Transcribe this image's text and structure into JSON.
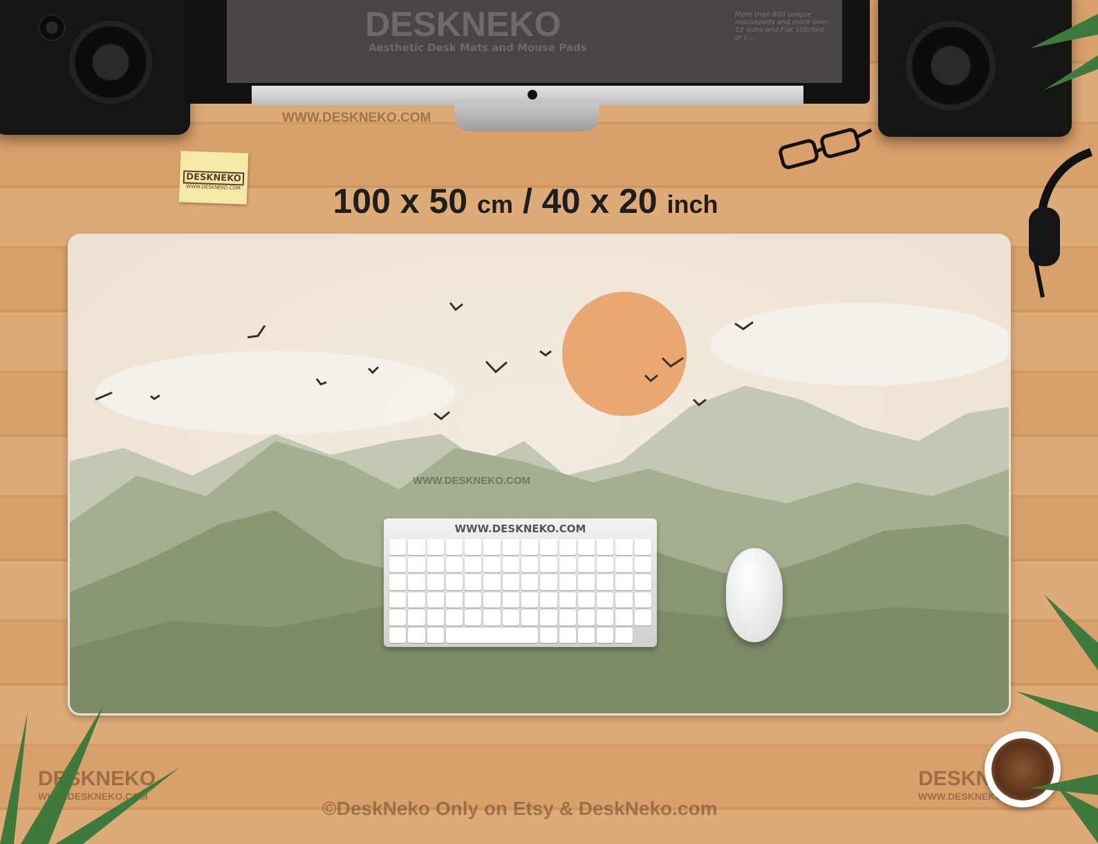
{
  "monitor": {
    "screen_brand": "DESKNEKO",
    "screen_tagline": "Aesthetic Desk Mats and Mouse Pads",
    "screen_side_text": "More than 800 unique mousepads and more over 12 sizes and Flat Stitched or L..."
  },
  "watermarks": {
    "url_top": "WWW.DESKNEKO.COM",
    "url_mat": "WWW.DESKNEKO.COM",
    "url_keyboard": "WWW.DESKNEKO.COM",
    "copyright": "©DeskNeko Only on Etsy & DeskNeko.com",
    "logo_left": "DESKNEKO",
    "logo_left_url": "WWW.DESKNEKO.COM",
    "logo_right": "DESKNEKO",
    "logo_right_url": "WWW.DESKNEKO.COM"
  },
  "sticky_note": {
    "brand": "DESKNEKO",
    "url": "WWW.DESKNEKO.COM"
  },
  "dimensions": {
    "cm_value": "100 x 50",
    "cm_unit": "cm",
    "sep": "/",
    "inch_value": "40 x 20",
    "inch_unit": "inch"
  },
  "colors": {
    "wood": "#d8a06b",
    "sky": "#efe5d8",
    "sun": "#eba771",
    "mountain_light": "#b5bea4",
    "mountain_mid": "#98a584",
    "mountain_dark": "#7f8f6c"
  }
}
